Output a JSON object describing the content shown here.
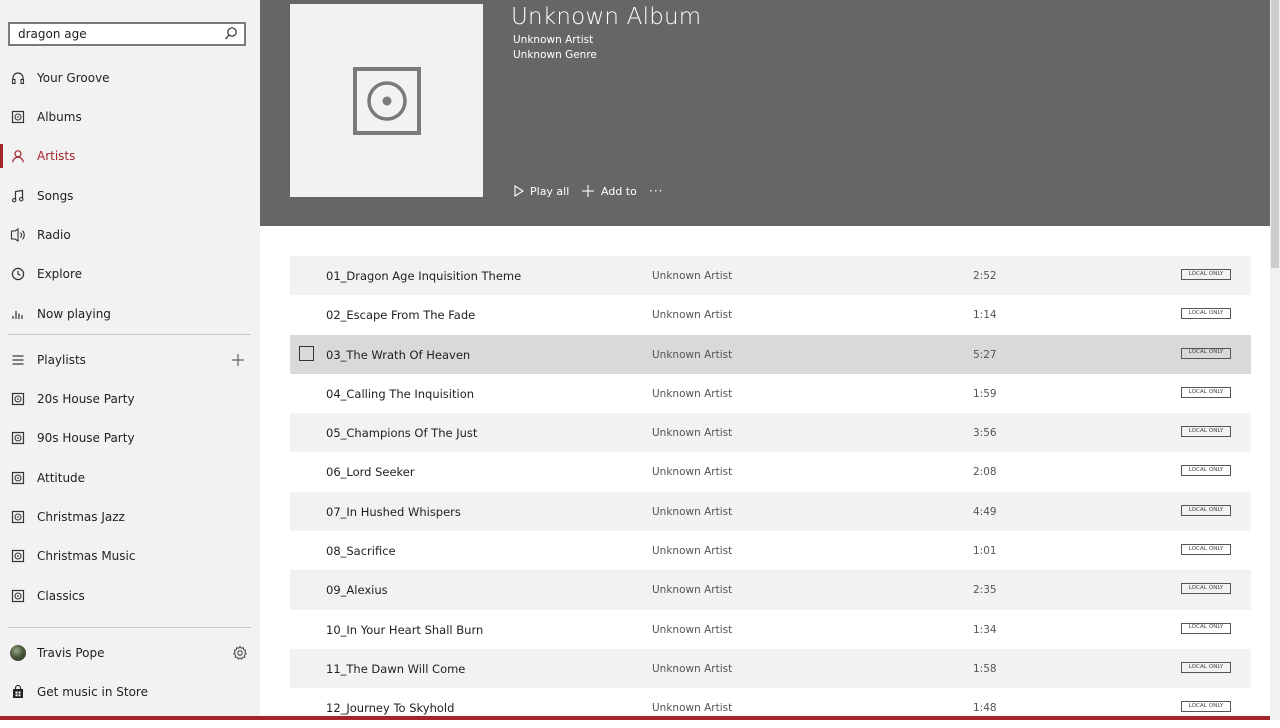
{
  "search": {
    "value": "dragon age",
    "placeholder": ""
  },
  "nav": {
    "items": [
      {
        "label": "Your Groove",
        "icon": "headphones-icon"
      },
      {
        "label": "Albums",
        "icon": "album-icon"
      },
      {
        "label": "Artists",
        "icon": "person-icon",
        "active": true
      },
      {
        "label": "Songs",
        "icon": "music-note-icon"
      },
      {
        "label": "Radio",
        "icon": "radio-icon"
      },
      {
        "label": "Explore",
        "icon": "explore-icon"
      },
      {
        "label": "Now playing",
        "icon": "equalizer-icon"
      }
    ],
    "playlists_label": "Playlists",
    "playlists": [
      "20s House Party",
      "90s House Party",
      "Attitude",
      "Christmas Jazz",
      "Christmas Music",
      "Classics"
    ],
    "user_name": "Travis Pope",
    "store_label": "Get music in Store"
  },
  "album": {
    "title": "Unknown Album",
    "artist": "Unknown Artist",
    "genre": "Unknown Genre",
    "actions": {
      "play_all": "Play all",
      "add_to": "Add to",
      "more": "···"
    }
  },
  "tracks": [
    {
      "title": "01_Dragon Age Inquisition Theme",
      "artist": "Unknown Artist",
      "duration": "2:52",
      "badge": "LOCAL ONLY"
    },
    {
      "title": "02_Escape From The Fade",
      "artist": "Unknown Artist",
      "duration": "1:14",
      "badge": "LOCAL ONLY"
    },
    {
      "title": "03_The Wrath Of Heaven",
      "artist": "Unknown Artist",
      "duration": "5:27",
      "badge": "LOCAL ONLY"
    },
    {
      "title": "04_Calling The Inquisition",
      "artist": "Unknown Artist",
      "duration": "1:59",
      "badge": "LOCAL ONLY"
    },
    {
      "title": "05_Champions Of The Just",
      "artist": "Unknown Artist",
      "duration": "3:56",
      "badge": "LOCAL ONLY"
    },
    {
      "title": "06_Lord Seeker",
      "artist": "Unknown Artist",
      "duration": "2:08",
      "badge": "LOCAL ONLY"
    },
    {
      "title": "07_In Hushed Whispers",
      "artist": "Unknown Artist",
      "duration": "4:49",
      "badge": "LOCAL ONLY"
    },
    {
      "title": "08_Sacrifice",
      "artist": "Unknown Artist",
      "duration": "1:01",
      "badge": "LOCAL ONLY"
    },
    {
      "title": "09_Alexius",
      "artist": "Unknown Artist",
      "duration": "2:35",
      "badge": "LOCAL ONLY"
    },
    {
      "title": "10_In Your Heart Shall Burn",
      "artist": "Unknown Artist",
      "duration": "1:34",
      "badge": "LOCAL ONLY"
    },
    {
      "title": "11_The Dawn Will Come",
      "artist": "Unknown Artist",
      "duration": "1:58",
      "badge": "LOCAL ONLY"
    },
    {
      "title": "12_Journey To Skyhold",
      "artist": "Unknown Artist",
      "duration": "1:48",
      "badge": "LOCAL ONLY"
    }
  ],
  "colors": {
    "accent": "#a4262c",
    "header_bg": "#666666",
    "sidebar_bg": "#f2f2f2"
  }
}
